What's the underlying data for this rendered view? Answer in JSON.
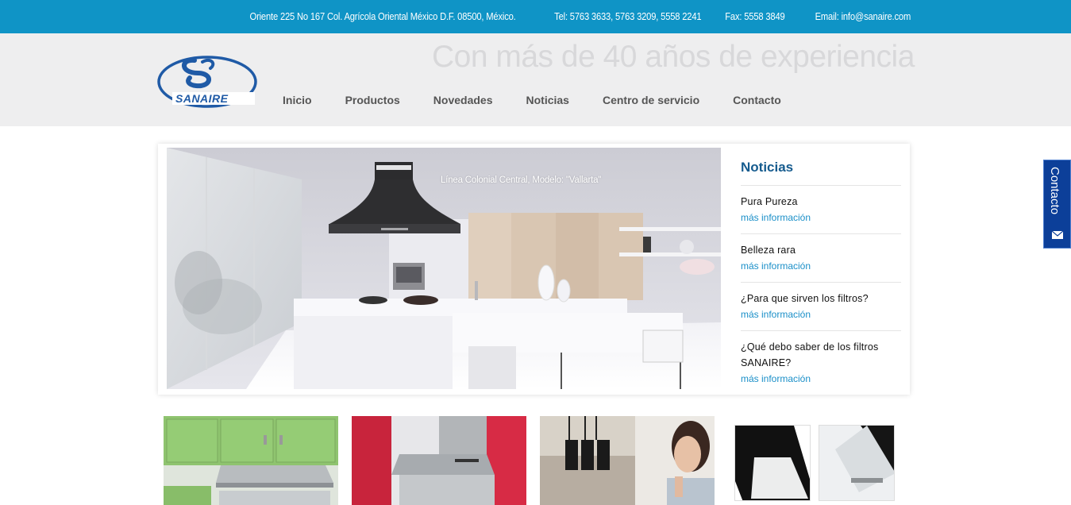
{
  "topbar": {
    "address": "Oriente 225 No 167 Col. Agrícola Oriental México D.F. 08500, México.",
    "phone": "Tel: 5763 3633, 5763 3209, 5558 2241",
    "fax": "Fax: 5558 3849",
    "email": "Email: info@sanaire.com"
  },
  "header": {
    "slogan": "Con más de 40 años de experiencia",
    "logo_text": "SANAIRE",
    "nav": [
      "Inicio",
      "Productos",
      "Novedades",
      "Noticias",
      "Centro de servicio",
      "Contacto"
    ]
  },
  "hero": {
    "caption": "Línea Colonial Central, Modelo: \"Vallarta\""
  },
  "news": {
    "heading": "Noticias",
    "items": [
      {
        "title": "Pura Pureza",
        "link": "más información"
      },
      {
        "title": "Belleza rara",
        "link": "más información"
      },
      {
        "title": "¿Para que sirven los filtros?",
        "link": "más información"
      },
      {
        "title": "¿Qué debo saber de los filtros SANAIRE?",
        "link": "más información"
      }
    ]
  },
  "contact_tab": {
    "label": "Contacto",
    "icon": "envelope-icon"
  },
  "colors": {
    "topbar": "#0f94c6",
    "header_bg": "#eeeeef",
    "news_heading": "#155b8e",
    "link": "#1a8fc8",
    "contact_tab": "#0c3f99",
    "logo_blue": "#1f5aa6"
  }
}
